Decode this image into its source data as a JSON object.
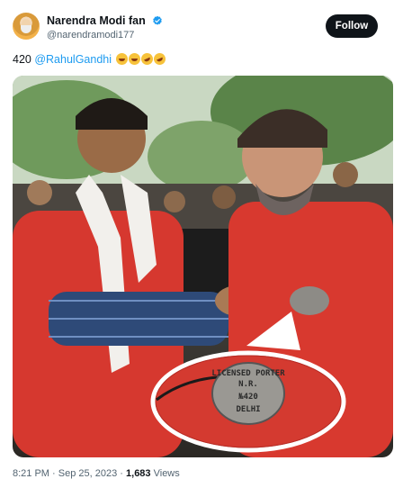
{
  "author": {
    "display_name": "Narendra Modi fan",
    "handle": "@narendramodi177",
    "verified": true
  },
  "follow_button": {
    "label": "Follow"
  },
  "tweet": {
    "prefix": "420",
    "mention": "@RahulGandhi",
    "emojis": [
      "laughing-face",
      "laughing-face",
      "rofl-face",
      "rofl-face"
    ]
  },
  "media": {
    "badge_lines": [
      "LICENSED PORTER",
      "N.R.",
      "№420",
      "DELHI"
    ]
  },
  "meta": {
    "time": "8:21 PM",
    "sep1": "·",
    "date": "Sep 25, 2023",
    "sep2": "·",
    "views_count": "1,683",
    "views_label": "Views"
  },
  "colors": {
    "accent": "#1d9bf0",
    "follow_bg": "#0f1419",
    "porter_red": "#d6382f"
  }
}
